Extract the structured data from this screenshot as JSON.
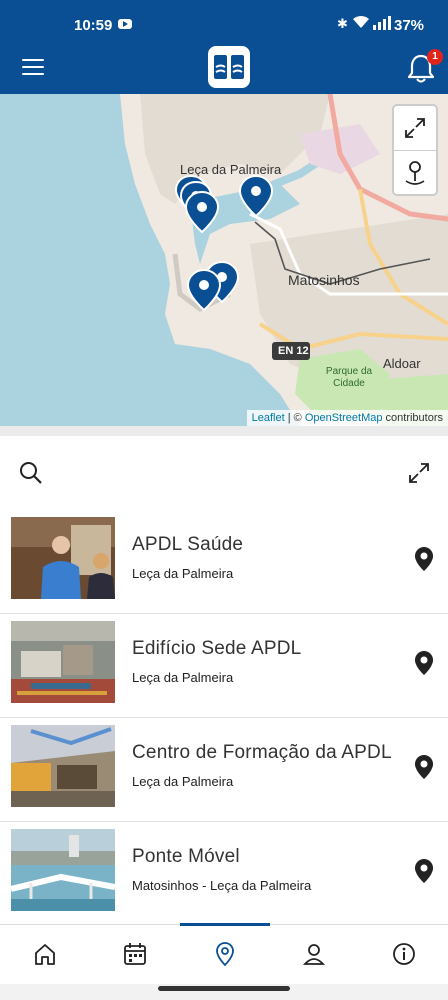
{
  "status_bar": {
    "time": "10:59",
    "battery": "37%"
  },
  "header": {
    "notification_count": "1",
    "icons": [
      "menu-icon",
      "app-logo",
      "bell-icon"
    ]
  },
  "map": {
    "labels": {
      "leca": "Leça da Palmeira",
      "matosinhos": "Matosinhos",
      "aldoar": "Aldoar",
      "road": "EN 12",
      "park": "Parque da Cidade"
    },
    "attribution": {
      "leaflet": "Leaflet",
      "separator": " | © ",
      "osm": "OpenStreetMap",
      "suffix": " contributors"
    },
    "colors": {
      "sea": "#aad3df",
      "marker": "#0a4f93"
    }
  },
  "poi_list": [
    {
      "name": "APDL Saúde",
      "place": "Leça da Palmeira"
    },
    {
      "name": "Edifício Sede APDL",
      "place": "Leça da Palmeira"
    },
    {
      "name": "Centro de Formação da APDL",
      "place": "Leça da Palmeira"
    },
    {
      "name": "Ponte Móvel",
      "place": "Matosinhos - Leça da Palmeira"
    }
  ],
  "bottom_nav": {
    "items": [
      "home-icon",
      "calendar-icon",
      "map-pin-icon",
      "user-icon",
      "info-icon"
    ],
    "active": "map-pin-icon"
  },
  "theme": {
    "primary": "#0a4f93"
  }
}
